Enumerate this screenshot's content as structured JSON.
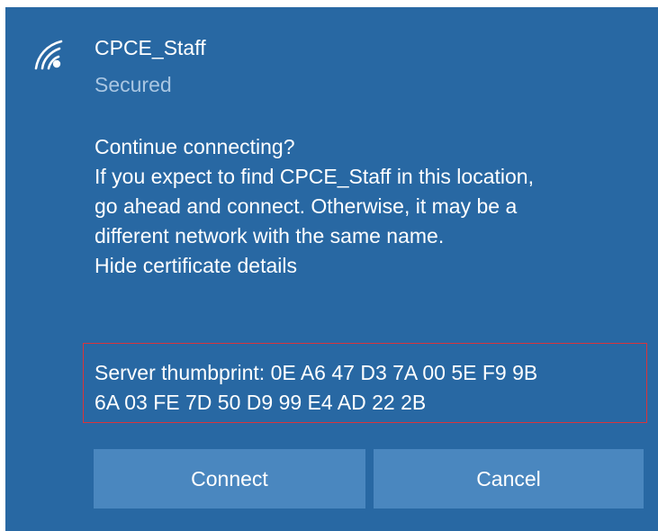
{
  "network": {
    "name": "CPCE_Staff",
    "status": "Secured",
    "icon": "wifi-secured-icon"
  },
  "message": {
    "heading": "Continue connecting?",
    "lines": [
      "If you expect to find CPCE_Staff in this location,",
      "go ahead and connect. Otherwise, it may be a",
      "different network with the same name."
    ],
    "toggle_link": "Hide certificate details"
  },
  "certificate": {
    "thumbprint_lines": [
      "Server thumbprint: 0E A6 47 D3 7A 00 5E F9 9B",
      "6A 03 FE 7D 50 D9 99 E4 AD 22 2B"
    ],
    "highlight_color": "#d9343b"
  },
  "buttons": {
    "connect": "Connect",
    "cancel": "Cancel"
  },
  "colors": {
    "panel_bg": "#2868a3",
    "button_bg": "#4a87bf",
    "secondary_text": "#a9c6e2"
  }
}
